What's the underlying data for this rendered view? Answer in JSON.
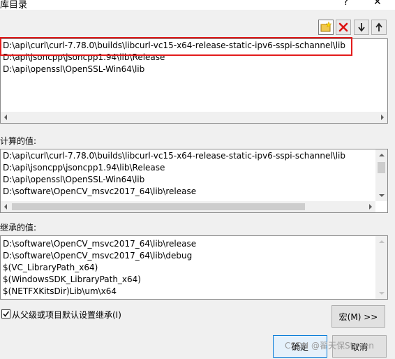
{
  "window": {
    "title": "库目录",
    "help_label": "?",
    "close_label": "✕"
  },
  "toolbar": {
    "buttons": [
      {
        "icon": "new-line-icon"
      },
      {
        "icon": "delete-line-icon"
      },
      {
        "icon": "move-down-icon"
      },
      {
        "icon": "move-up-icon"
      }
    ]
  },
  "editor": {
    "lines": [
      "D:\\api\\curl\\curl-7.78.0\\builds\\libcurl-vc15-x64-release-static-ipv6-sspi-schannel\\lib",
      "D:\\api\\jsoncpp\\jsoncpp1.94\\lib\\Release",
      "D:\\api\\openssl\\OpenSSL-Win64\\lib"
    ]
  },
  "computed": {
    "label": "计算的值:",
    "lines": [
      "D:\\api\\curl\\curl-7.78.0\\builds\\libcurl-vc15-x64-release-static-ipv6-sspi-schannel\\lib",
      "D:\\api\\jsoncpp\\jsoncpp1.94\\lib\\Release",
      "D:\\api\\openssl\\OpenSSL-Win64\\lib",
      "D:\\software\\OpenCV_msvc2017_64\\lib\\release"
    ]
  },
  "inherited": {
    "label": "继承的值:",
    "lines": [
      "D:\\software\\OpenCV_msvc2017_64\\lib\\release",
      "D:\\software\\OpenCV_msvc2017_64\\lib\\debug",
      "$(VC_LibraryPath_x64)",
      "$(WindowsSDK_LibraryPath_x64)",
      "$(NETFXKitsDir)Lib\\um\\x64"
    ]
  },
  "inherit_checkbox": {
    "label": "从父级或项目默认设置继承(I)",
    "checked": true
  },
  "macro_button": {
    "label": "宏(M) >>"
  },
  "ok_button": {
    "label": "确定"
  },
  "cancel_button": {
    "label": "取消"
  },
  "watermark": {
    "text": "CSDN @翟天保Steven"
  },
  "colors": {
    "highlight": "#e31b1b"
  }
}
